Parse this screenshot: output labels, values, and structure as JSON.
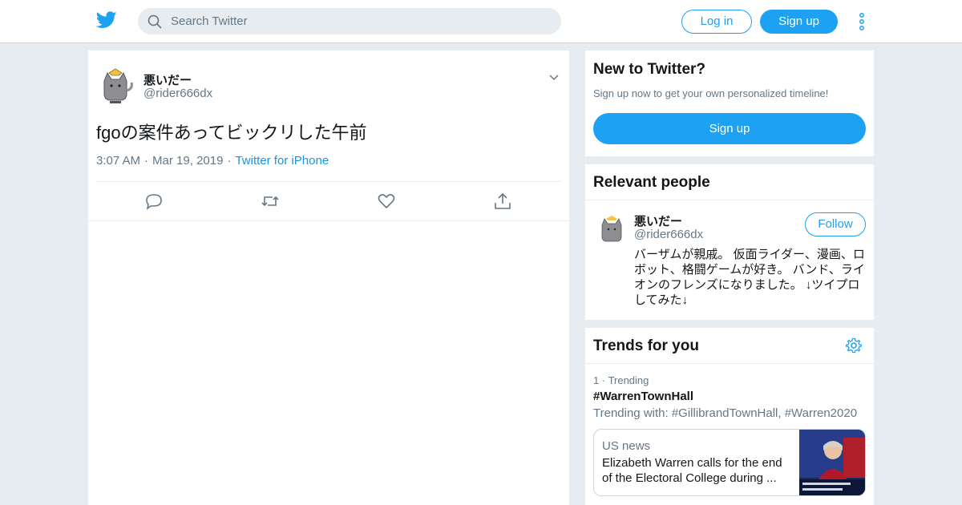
{
  "header": {
    "search_placeholder": "Search Twitter",
    "login_label": "Log in",
    "signup_label": "Sign up",
    "brand_color": "#1da1f2",
    "logo_icon": "twitter-bird-icon",
    "more_icon": "vertical-dots-icon"
  },
  "tweet": {
    "author_name": "悪いだー",
    "author_handle": "@rider666dx",
    "text": "fgoの案件あってビックリした午前",
    "time": "3:07 AM",
    "date": "Mar 19, 2019",
    "source": "Twitter for iPhone",
    "actions": [
      "reply-icon",
      "retweet-icon",
      "like-icon",
      "share-icon"
    ]
  },
  "new_to_twitter": {
    "title": "New to Twitter?",
    "subtitle": "Sign up now to get your own personalized timeline!",
    "button": "Sign up"
  },
  "relevant_people": {
    "title": "Relevant people",
    "name": "悪いだー",
    "handle": "@rider666dx",
    "follow_label": "Follow",
    "bio": "バーザムが親戚。 仮面ライダー、漫画、ロボット、格闘ゲームが好き。 バンド、ライオンのフレンズになりました。 ↓ツイプロしてみた↓"
  },
  "trends": {
    "title": "Trends for you",
    "rank": "1",
    "label": "Trending",
    "hashtag": "#WarrenTownHall",
    "trending_with": "Trending with: #GillibrandTownHall, #Warren2020",
    "news": {
      "category": "US news",
      "title": "Elizabeth Warren calls for the end of the Electoral College during ..."
    }
  }
}
